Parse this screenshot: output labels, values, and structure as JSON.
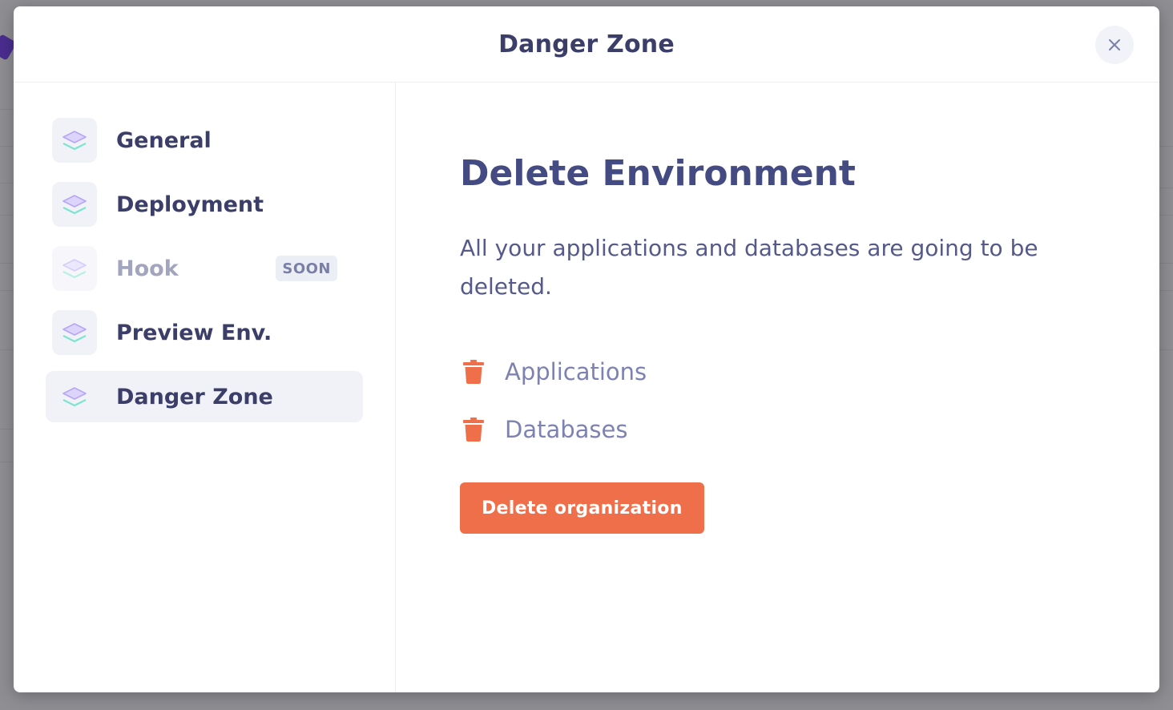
{
  "modal": {
    "title": "Danger Zone",
    "close_icon": "close-icon"
  },
  "sidebar": {
    "items": [
      {
        "label": "General",
        "icon": "layers-icon",
        "state": "default"
      },
      {
        "label": "Deployment",
        "icon": "layers-icon",
        "state": "default"
      },
      {
        "label": "Hook",
        "icon": "layers-icon",
        "state": "disabled",
        "badge": "SOON"
      },
      {
        "label": "Preview Env.",
        "icon": "layers-icon",
        "state": "default"
      },
      {
        "label": "Danger Zone",
        "icon": "layers-icon",
        "state": "active"
      }
    ]
  },
  "content": {
    "title": "Delete Environment",
    "description": "All your applications and databases are going to be deleted.",
    "items": [
      {
        "label": "Applications",
        "icon": "trash-icon"
      },
      {
        "label": "Databases",
        "icon": "trash-icon"
      }
    ],
    "button_label": "Delete organization"
  },
  "colors": {
    "danger": "#ef6f4b",
    "title": "#444a82",
    "accent_purple": "#b8a6f5",
    "accent_teal": "#7fe3d0"
  }
}
